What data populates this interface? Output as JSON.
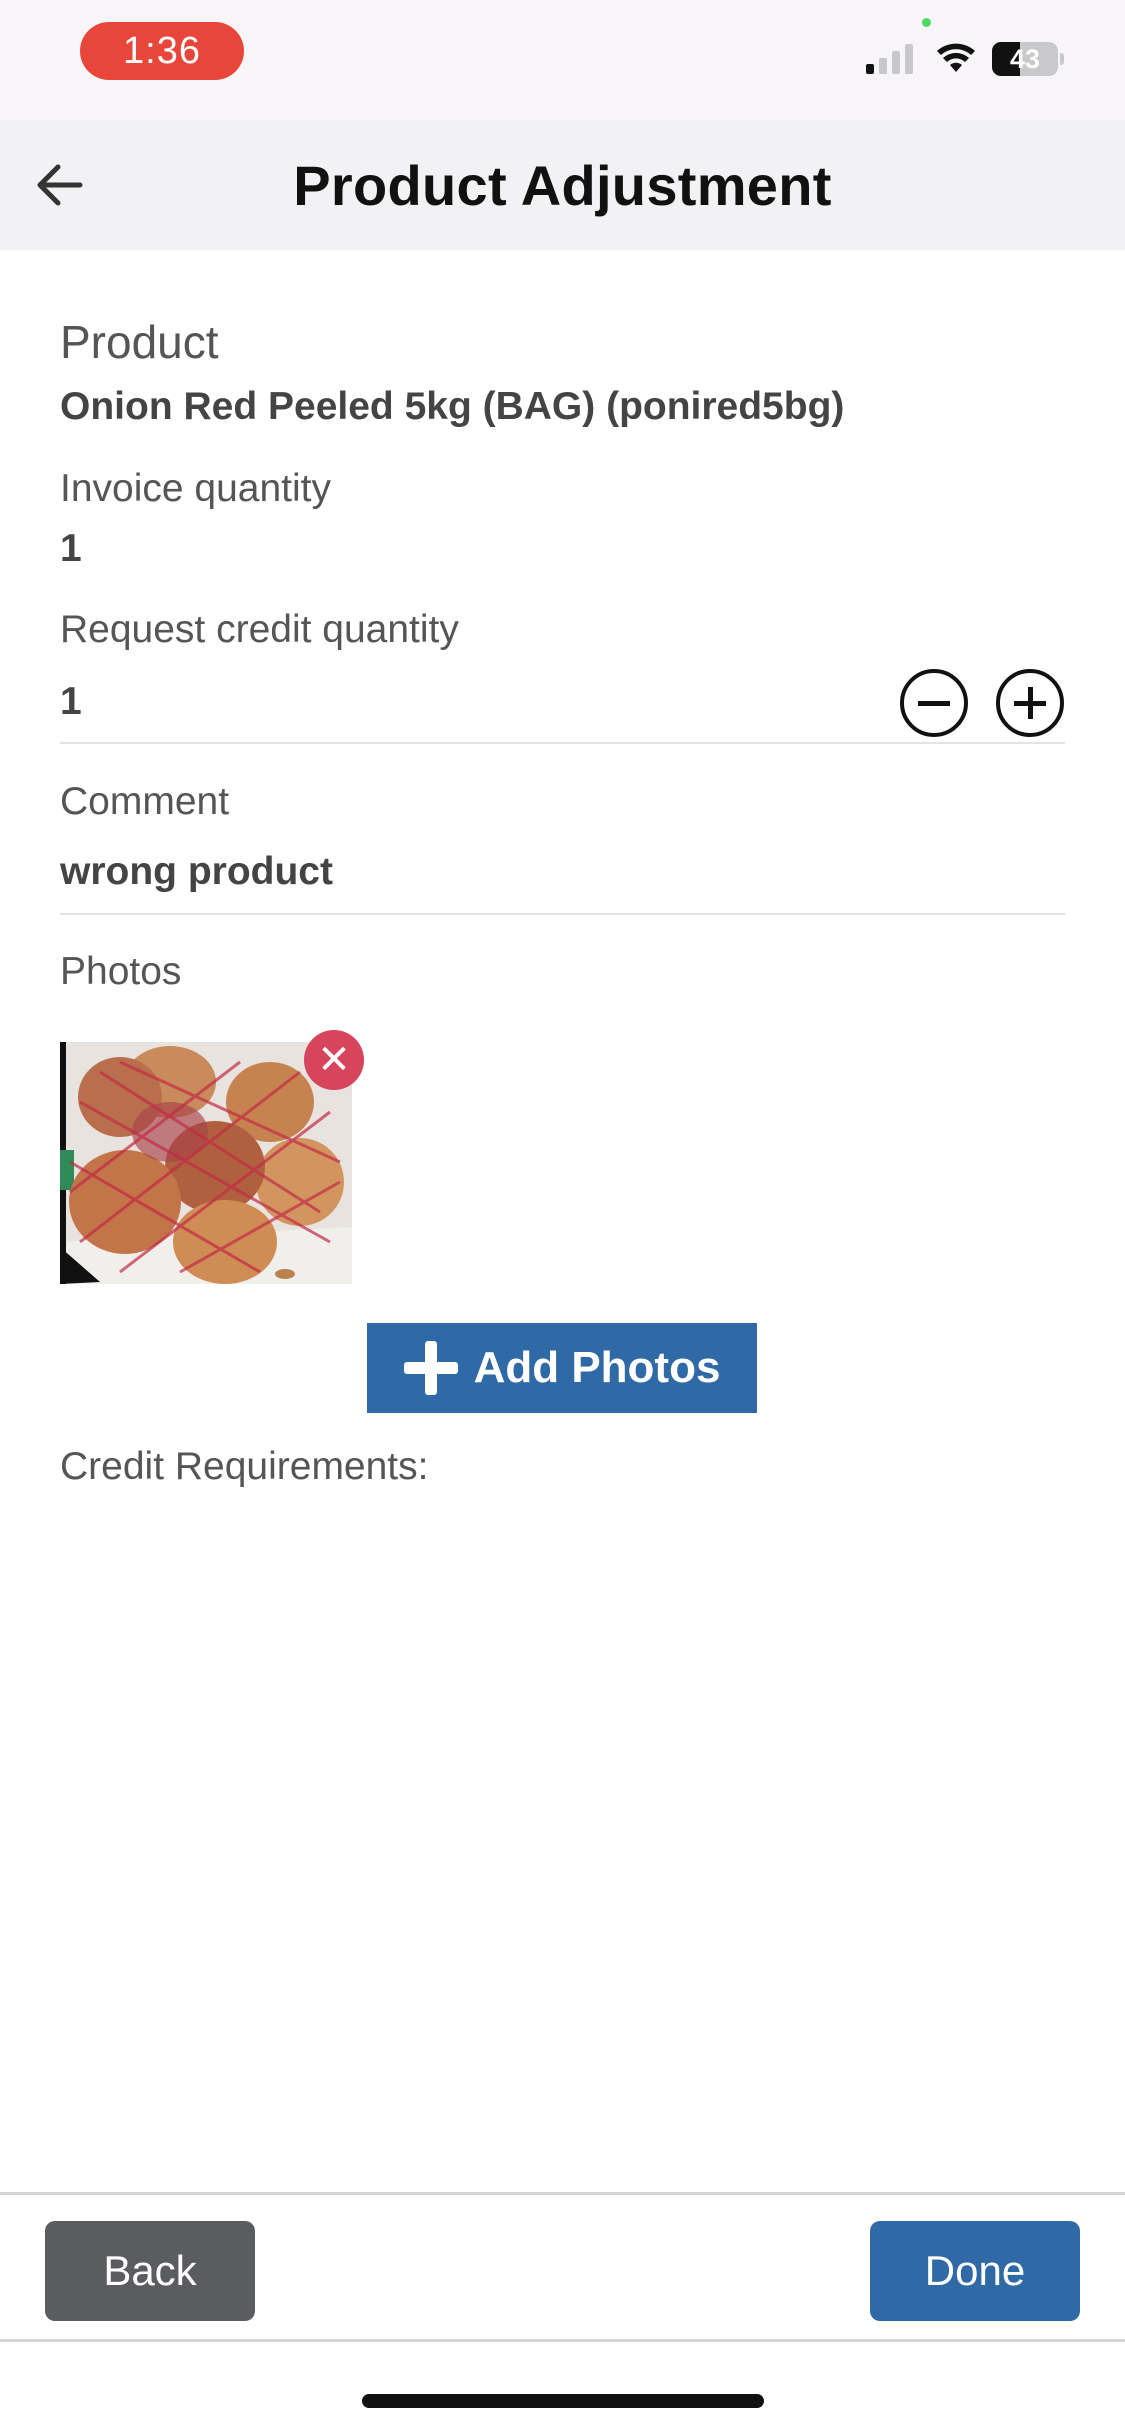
{
  "status_bar": {
    "time": "1:36",
    "battery": "43",
    "battery_level": 0.43,
    "signal_bars_active": 1,
    "signal_bars_total": 4
  },
  "header": {
    "title": "Product Adjustment",
    "back_icon": "arrow-left-icon"
  },
  "form": {
    "product_label": "Product",
    "product_value": "Onion Red Peeled 5kg  (BAG) (ponired5bg)",
    "invoice_qty_label": "Invoice quantity",
    "invoice_qty_value": "1",
    "request_qty_label": "Request credit quantity",
    "request_qty_value": "1",
    "comment_label": "Comment",
    "comment_value": "wrong product",
    "photos_label": "Photos",
    "add_photos_label": "Add Photos",
    "remove_photo_icon": "close-icon",
    "credit_requirements_label": "Credit Requirements:"
  },
  "footer": {
    "back_label": "Back",
    "done_label": "Done"
  },
  "colors": {
    "primary": "#2f6aa6",
    "secondary": "#5a5c5f",
    "danger": "#d6455b",
    "time_pill": "#e8463a"
  }
}
